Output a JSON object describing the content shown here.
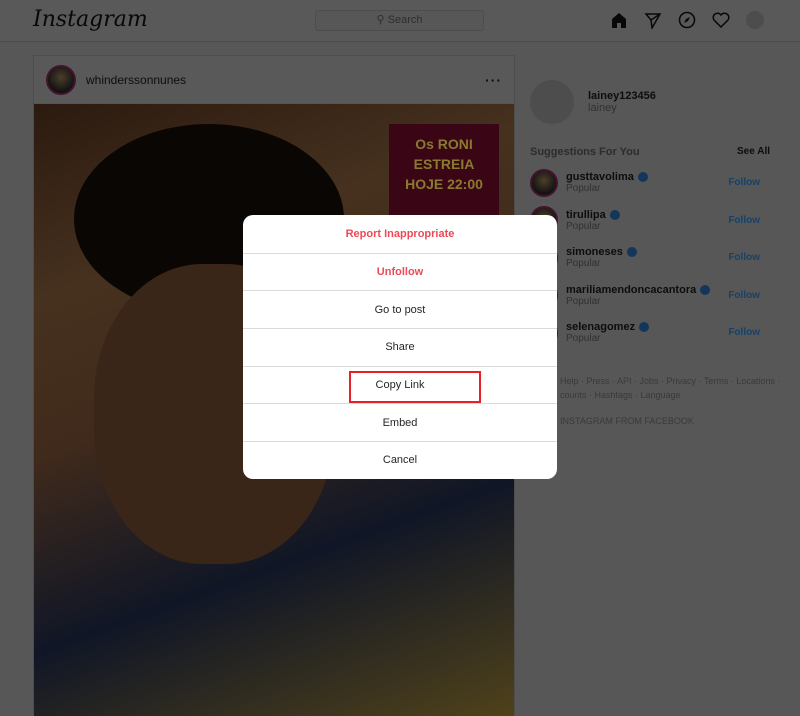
{
  "header": {
    "logo": "Instagram",
    "search_placeholder": "Search",
    "icons": [
      "home-icon",
      "direct-icon",
      "explore-icon",
      "heart-icon",
      "profile-avatar"
    ]
  },
  "post": {
    "username": "whinderssonnunes",
    "more": "···",
    "poster": {
      "line1": "Os RONI",
      "line2": "ESTREIA",
      "line3": "HOJE 22:00"
    }
  },
  "sidebar": {
    "username": "lainey123456",
    "name": "lainey",
    "suggestions_title": "Suggestions For You",
    "see_all": "See All",
    "suggestions": [
      {
        "name": "gusttavolima",
        "sub": "Popular",
        "action": "Follow"
      },
      {
        "name": "tirullipa",
        "sub": "Popular",
        "action": "Follow"
      },
      {
        "name": "simoneses",
        "sub": "Popular",
        "action": "Follow"
      },
      {
        "name": "mariliamendoncacantora",
        "sub": "Popular",
        "action": "Follow"
      },
      {
        "name": "selenagomez",
        "sub": "Popular",
        "action": "Follow"
      }
    ],
    "footer_line1": "Help · Press · API · Jobs · Privacy · Terms · Locations ·",
    "footer_line2": "counts · Hashtags · Language",
    "footer_line3": "INSTAGRAM FROM FACEBOOK"
  },
  "modal": {
    "options": [
      {
        "label": "Report Inappropriate",
        "style": "danger"
      },
      {
        "label": "Unfollow",
        "style": "danger"
      },
      {
        "label": "Go to post"
      },
      {
        "label": "Share"
      },
      {
        "label": "Copy Link",
        "highlighted": true,
        "highlight_color": "#e8202a"
      },
      {
        "label": "Embed"
      },
      {
        "label": "Cancel"
      }
    ]
  }
}
